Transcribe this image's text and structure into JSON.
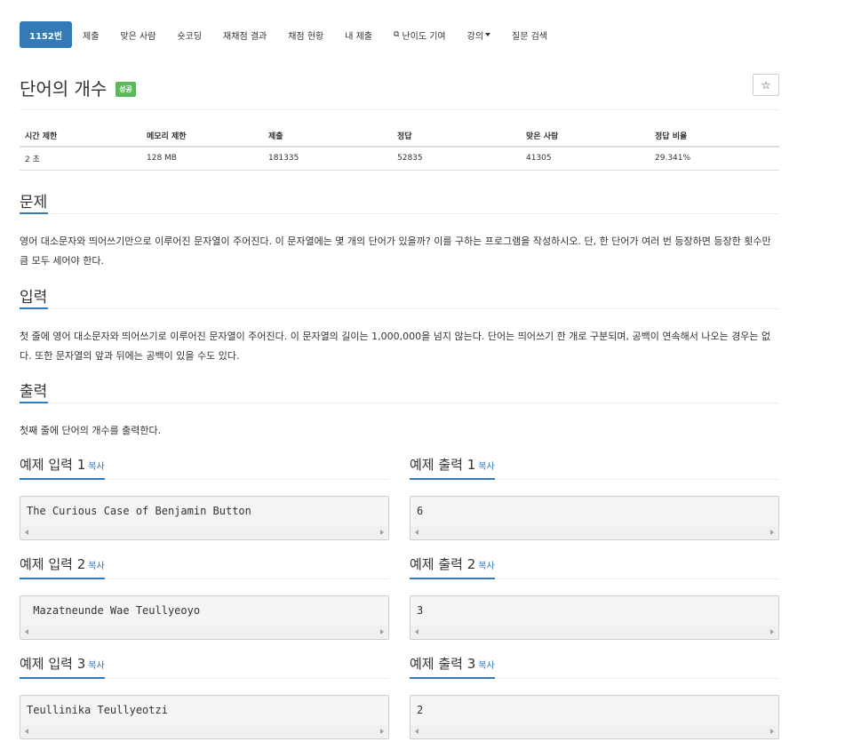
{
  "nav": {
    "items": [
      "1152번",
      "제출",
      "맞은 사람",
      "숏코딩",
      "재채점 결과",
      "채점 현황",
      "내 제출",
      "난이도 기여",
      "강의",
      "질문 검색"
    ]
  },
  "problem": {
    "title": "단어의 개수",
    "badge": "성공",
    "star": "☆"
  },
  "info": {
    "headers": [
      "시간 제한",
      "메모리 제한",
      "제출",
      "정답",
      "맞은 사람",
      "정답 비율"
    ],
    "values": [
      "2 초",
      "128 MB",
      "181335",
      "52835",
      "41305",
      "29.341%"
    ]
  },
  "sections": {
    "problem_heading": "문제",
    "problem_text": "영어 대소문자와 띄어쓰기만으로 이루어진 문자열이 주어진다. 이 문자열에는 몇 개의 단어가 있을까? 이를 구하는 프로그램을 작성하시오. 단, 한 단어가 여러 번 등장하면 등장한 횟수만큼 모두 세어야 한다.",
    "input_heading": "입력",
    "input_text": "첫 줄에 영어 대소문자와 띄어쓰기로 이루어진 문자열이 주어진다. 이 문자열의 길이는 1,000,000을 넘지 않는다. 단어는 띄어쓰기 한 개로 구분되며, 공백이 연속해서 나오는 경우는 없다. 또한 문자열의 앞과 뒤에는 공백이 있을 수도 있다.",
    "output_heading": "출력",
    "output_text": "첫째 줄에 단어의 개수를 출력한다."
  },
  "samples": {
    "copy_label": "복사",
    "input1_title": "예제 입력 1",
    "input1": "The Curious Case of Benjamin Button",
    "output1_title": "예제 출력 1",
    "output1": "6",
    "input2_title": "예제 입력 2",
    "input2": " Mazatneunde Wae Teullyeoyo",
    "output2_title": "예제 출력 2",
    "output2": "3",
    "input3_title": "예제 입력 3",
    "input3": "Teullinika Teullyeotzi ",
    "output3_title": "예제 출력 3",
    "output3": "2"
  }
}
